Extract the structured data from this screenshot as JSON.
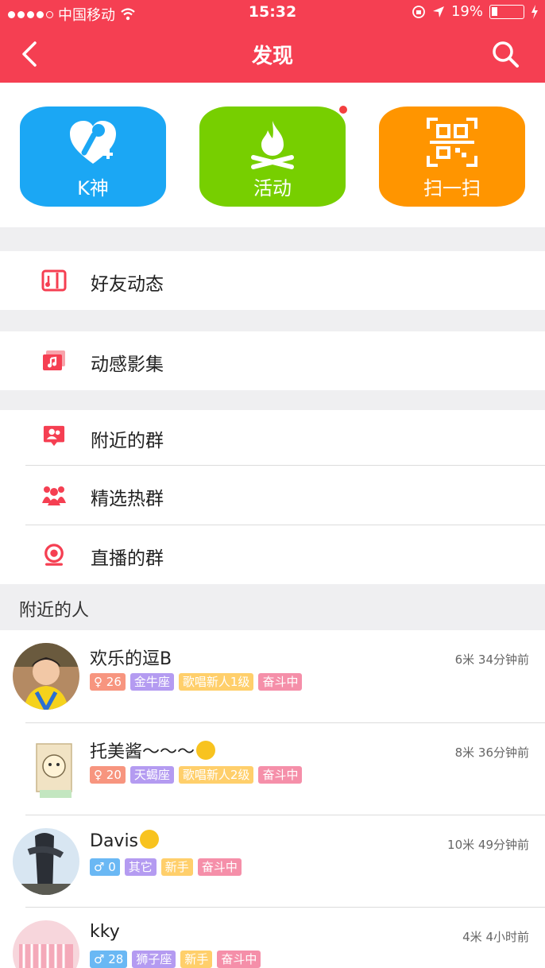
{
  "status_bar": {
    "carrier": "中国移动",
    "time": "15:32",
    "battery": "19%"
  },
  "nav": {
    "title": "发现"
  },
  "tiles": [
    {
      "label": "K神",
      "color": "#1ba7f4",
      "icon": "karaoke-mic-heart-icon"
    },
    {
      "label": "活动",
      "color": "#77cf00",
      "icon": "campfire-icon",
      "has_badge": true
    },
    {
      "label": "扫一扫",
      "color": "#ff9500",
      "icon": "qr-scan-icon"
    }
  ],
  "menu": {
    "friends_feed": "好友动态",
    "dynamic_album": "动感影集",
    "nearby_groups": "附近的群",
    "featured_groups": "精选热群",
    "live_groups": "直播的群"
  },
  "nearby_people": {
    "header": "附近的人",
    "people": [
      {
        "name": "欢乐的逗B",
        "meta": "6米 34分钟前",
        "gender": "female",
        "age": "26",
        "zodiac": "金牛座",
        "level": "歌唱新人1级",
        "status": "奋斗中"
      },
      {
        "name": "托美酱～～～",
        "meta": "8米 36分钟前",
        "gender": "female",
        "age": "20",
        "zodiac": "天蝎座",
        "level": "歌唱新人2级",
        "status": "奋斗中"
      },
      {
        "name": "Davis",
        "meta": "10米 49分钟前",
        "gender": "male",
        "age": "0",
        "zodiac": "其它",
        "level": "新手",
        "status": "奋斗中"
      },
      {
        "name": "kky",
        "meta": "4米 4小时前",
        "gender": "male",
        "age": "28",
        "zodiac": "狮子座",
        "level": "新手",
        "status": "奋斗中"
      }
    ]
  },
  "colors": {
    "brand": "#f53f52",
    "background_gap": "#efeff1"
  }
}
